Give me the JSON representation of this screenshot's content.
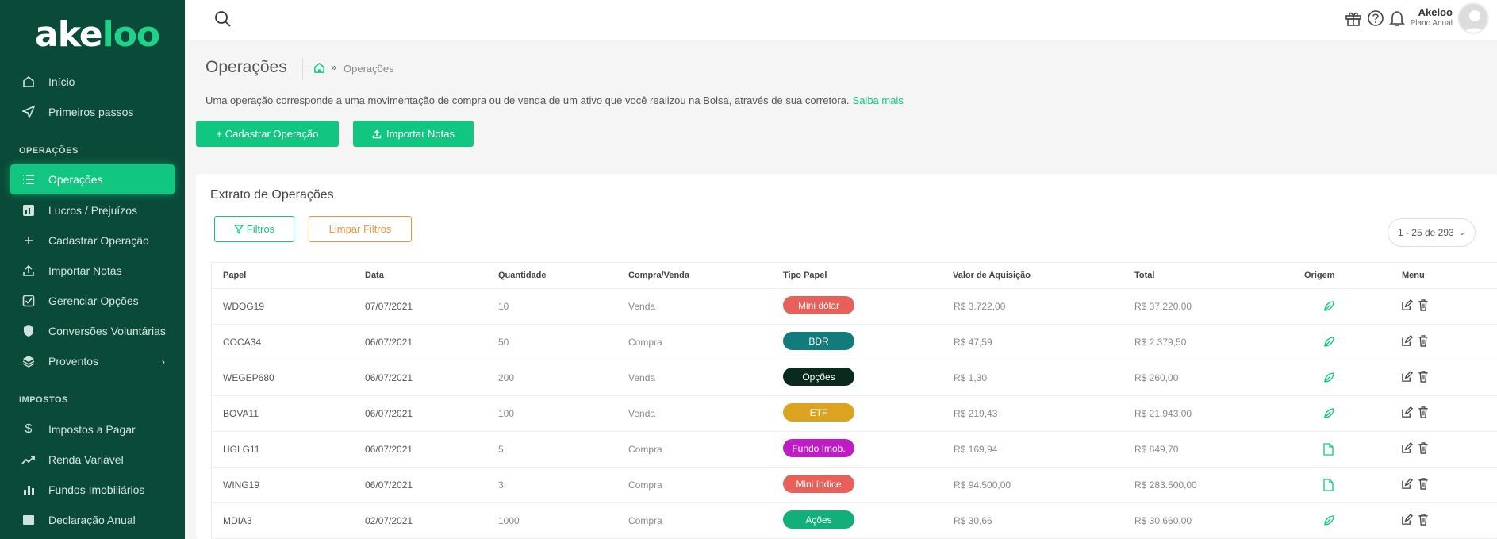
{
  "brand": {
    "logo_prefix": "ake",
    "logo_suffix": "loo",
    "accent": "#11c680",
    "sidebar_bg": "#0a4a38"
  },
  "sidebar": {
    "items_top": [
      {
        "label": "Início",
        "icon": "home-icon"
      },
      {
        "label": "Primeiros passos",
        "icon": "paper-plane-icon"
      }
    ],
    "section_operacoes": "OPERAÇÕES",
    "items_operacoes": [
      {
        "label": "Operações",
        "icon": "list-icon"
      },
      {
        "label": "Lucros / Prejuízos",
        "icon": "chart-box-icon"
      },
      {
        "label": "Cadastrar Operação",
        "icon": "plus-icon"
      },
      {
        "label": "Importar Notas",
        "icon": "upload-icon"
      },
      {
        "label": "Gerenciar Opções",
        "icon": "checkbox-icon"
      },
      {
        "label": "Conversões Voluntárias",
        "icon": "shield-icon"
      },
      {
        "label": "Proventos",
        "icon": "stack-icon"
      }
    ],
    "section_impostos": "IMPOSTOS",
    "items_impostos": [
      {
        "label": "Impostos a Pagar",
        "icon": "dollar-icon"
      },
      {
        "label": "Renda Variável",
        "icon": "trend-icon"
      },
      {
        "label": "Fundos Imobiliários",
        "icon": "bar-chart-icon"
      },
      {
        "label": "Declaração Anual",
        "icon": "card-icon"
      }
    ]
  },
  "topbar": {
    "user_name": "Akeloo",
    "user_plan": "Plano Anual"
  },
  "page": {
    "title": "Operações",
    "breadcrumb_arrow": "»",
    "breadcrumb_current": "Operações",
    "description": "Uma operação corresponde a uma movimentação de compra ou de venda de um ativo que você realizou na Bolsa, através de sua corretora.",
    "description_link": "Saiba mais",
    "btn_cadastrar": "+ Cadastrar Operação",
    "btn_importar": "Importar Notas"
  },
  "card": {
    "title": "Extrato de Operações",
    "btn_filtros": "Filtros",
    "btn_limpar": "Limpar Filtros",
    "pager": "1 - 25 de 293",
    "columns": [
      "Papel",
      "Data",
      "Quantidade",
      "Compra/Venda",
      "Tipo Papel",
      "Valor de Aquisição",
      "Total",
      "Origem",
      "Menu"
    ],
    "rows": [
      {
        "papel": "WDOG19",
        "data": "07/07/2021",
        "quantidade": "10",
        "compra_venda": "Venda",
        "tipo": "Mini dólar",
        "tipo_color": "#e8605a",
        "valor": "R$ 3.722,00",
        "total": "R$ 37.220,00",
        "origem": "feather-icon"
      },
      {
        "papel": "COCA34",
        "data": "06/07/2021",
        "quantidade": "50",
        "compra_venda": "Compra",
        "tipo": "BDR",
        "tipo_color": "#127c7c",
        "valor": "R$ 47,59",
        "total": "R$ 2.379,50",
        "origem": "feather-icon"
      },
      {
        "papel": "WEGEP680",
        "data": "06/07/2021",
        "quantidade": "200",
        "compra_venda": "Venda",
        "tipo": "Opções",
        "tipo_color": "#0b2a1e",
        "valor": "R$ 1,30",
        "total": "R$ 260,00",
        "origem": "feather-icon"
      },
      {
        "papel": "BOVA11",
        "data": "06/07/2021",
        "quantidade": "100",
        "compra_venda": "Venda",
        "tipo": "ETF",
        "tipo_color": "#dca321",
        "valor": "R$ 219,43",
        "total": "R$ 21.943,00",
        "origem": "feather-icon"
      },
      {
        "papel": "HGLG11",
        "data": "06/07/2021",
        "quantidade": "5",
        "compra_venda": "Compra",
        "tipo": "Fundo Imob.",
        "tipo_color": "#c01cc6",
        "valor": "R$ 169,94",
        "total": "R$ 849,70",
        "origem": "file-icon"
      },
      {
        "papel": "WING19",
        "data": "06/07/2021",
        "quantidade": "3",
        "compra_venda": "Compra",
        "tipo": "Mini índice",
        "tipo_color": "#e8605a",
        "valor": "R$ 94.500,00",
        "total": "R$ 283.500,00",
        "origem": "file-icon"
      },
      {
        "papel": "MDIA3",
        "data": "02/07/2021",
        "quantidade": "1000",
        "compra_venda": "Compra",
        "tipo": "Ações",
        "tipo_color": "#11b07a",
        "valor": "R$ 30,66",
        "total": "R$ 30.660,00",
        "origem": "feather-icon"
      }
    ]
  }
}
